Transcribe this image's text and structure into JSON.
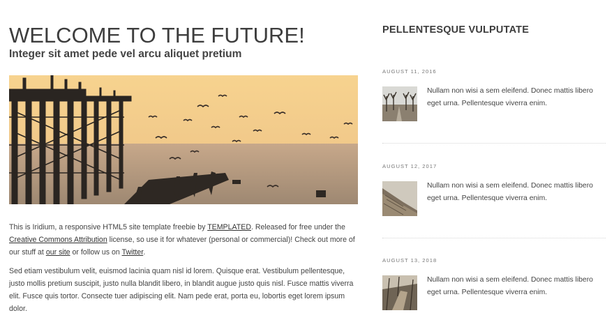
{
  "header": {
    "title": "WELCOME TO THE FUTURE!",
    "subtitle": "Integer sit amet pede vel arcu aliquet pretium"
  },
  "article": {
    "p1": {
      "before_templated": "This is Iridium, a responsive HTML5 site template freebie by ",
      "templated_link": "TEMPLATED",
      "after_templated": ". Released for free under the ",
      "cc_link": "Creative Commons Attribution",
      "after_cc": " license, so use it for whatever (personal or commercial)! Check out more of our stuff at ",
      "site_link": "our site",
      "after_site": " or follow us on ",
      "twitter_link": "Twitter",
      "end": "."
    },
    "p2": "Sed etiam vestibulum velit, euismod lacinia quam nisl id lorem. Quisque erat. Vestibulum pellentesque, justo mollis pretium suscipit, justo nulla blandit libero, in blandit augue justo quis nisl. Fusce mattis viverra elit. Fusce quis tortor. Consecte tuer adipiscing elit. Nam pede erat, porta eu, lobortis eget lorem ipsum dolor."
  },
  "sidebar": {
    "title": "PELLENTESQUE VULPUTATE",
    "posts": [
      {
        "date": "AUGUST 11, 2016",
        "text": "Nullam non wisi a sem eleifend. Donec mattis libero eget urna. Pellentesque viverra enim."
      },
      {
        "date": "AUGUST 12, 2017",
        "text": "Nullam non wisi a sem eleifend. Donec mattis libero eget urna. Pellentesque viverra enim."
      },
      {
        "date": "AUGUST 13, 2018",
        "text": "Nullam non wisi a sem eleifend. Donec mattis libero eget urna. Pellentesque viverra enim."
      }
    ]
  },
  "colors": {
    "heading": "#3d3d3d",
    "text": "#444444",
    "sky": "#f6d08a",
    "sea": "#b9a085"
  }
}
